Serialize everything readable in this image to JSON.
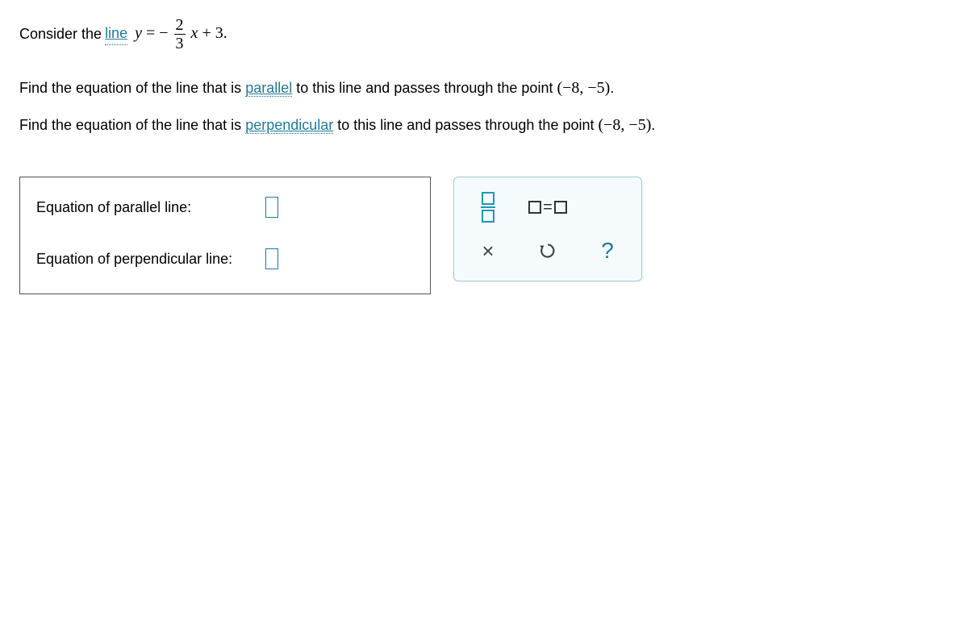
{
  "problem": {
    "intro_prefix": "Consider the ",
    "link_line": "line",
    "eq_var_y": "y",
    "eq_equals": "=",
    "eq_neg": "−",
    "eq_frac_num": "2",
    "eq_frac_den": "3",
    "eq_var_x": "x",
    "eq_plus_const": "+ 3.",
    "parallel_text_pre": "Find the equation of the line that is ",
    "link_parallel": "parallel",
    "parallel_text_post": " to this line and passes through the point ",
    "perp_text_pre": "Find the equation of the line that is ",
    "link_perpendicular": "perpendicular",
    "perp_text_post": " to this line and passes through the point ",
    "point": "(−8,  −5)",
    "period": "."
  },
  "answers": {
    "parallel_label": "Equation of parallel line:",
    "perpendicular_label": "Equation of perpendicular line:"
  },
  "keypad": {
    "equals": "=",
    "times": "×",
    "help": "?"
  }
}
